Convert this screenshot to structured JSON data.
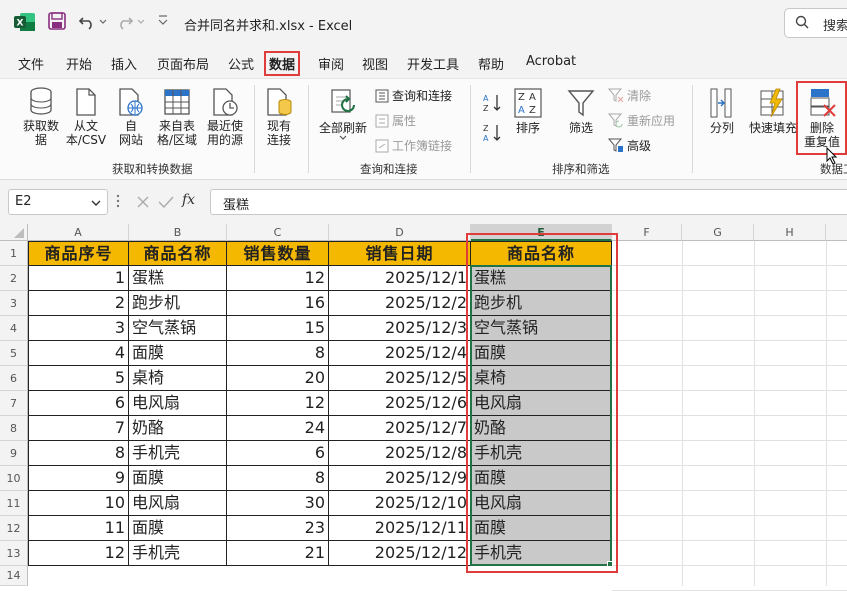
{
  "window": {
    "title": "合并同名并求和.xlsx  -  Excel",
    "search_label": "搜索"
  },
  "menu": [
    "文件",
    "开始",
    "插入",
    "页面布局",
    "公式",
    "数据",
    "审阅",
    "视图",
    "开发工具",
    "帮助",
    "Acrobat"
  ],
  "ribbon": {
    "get_data": "获取数\n据",
    "from_text_csv": "从文\n本/CSV",
    "from_web": "自\n网站",
    "from_table": "来自表\n格/区域",
    "recent_sources": "最近使\n用的源",
    "existing_connections": "现有\n连接",
    "group_get_transform": "获取和转换数据",
    "refresh_all": "全部刷新",
    "queries_connections": "查询和连接",
    "properties": "属性",
    "edit_links": "工作簿链接",
    "group_queries": "查询和连接",
    "sort_asc": "A↓Z",
    "sort_desc": "Z↓A",
    "sort": "排序",
    "filter": "筛选",
    "clear": "清除",
    "reapply": "重新应用",
    "advanced": "高级",
    "group_sort_filter": "排序和筛选",
    "text_to_columns": "分列",
    "flash_fill": "快速填充",
    "remove_duplicates": "删除\n重复值",
    "group_data_tools": "数据工"
  },
  "formula_bar": {
    "name_box": "E2",
    "fx": "fx",
    "value": "蛋糕"
  },
  "columns": [
    "A",
    "B",
    "C",
    "D",
    "E",
    "F",
    "G",
    "H"
  ],
  "rows": [
    "1",
    "2",
    "3",
    "4",
    "5",
    "6",
    "7",
    "8",
    "9",
    "10",
    "11",
    "12",
    "13",
    "14"
  ],
  "table": {
    "headers": [
      "商品序号",
      "商品名称",
      "销售数量",
      "销售日期",
      "商品名称"
    ],
    "rows": [
      [
        "1",
        "蛋糕",
        "12",
        "2025/12/1",
        "蛋糕"
      ],
      [
        "2",
        "跑步机",
        "16",
        "2025/12/2",
        "跑步机"
      ],
      [
        "3",
        "空气蒸锅",
        "15",
        "2025/12/3",
        "空气蒸锅"
      ],
      [
        "4",
        "面膜",
        "8",
        "2025/12/4",
        "面膜"
      ],
      [
        "5",
        "桌椅",
        "20",
        "2025/12/5",
        "桌椅"
      ],
      [
        "6",
        "电风扇",
        "12",
        "2025/12/6",
        "电风扇"
      ],
      [
        "7",
        "奶酪",
        "24",
        "2025/12/7",
        "奶酪"
      ],
      [
        "8",
        "手机壳",
        "6",
        "2025/12/8",
        "手机壳"
      ],
      [
        "9",
        "面膜",
        "8",
        "2025/12/9",
        "面膜"
      ],
      [
        "10",
        "电风扇",
        "30",
        "2025/12/10",
        "电风扇"
      ],
      [
        "11",
        "面膜",
        "23",
        "2025/12/11",
        "面膜"
      ],
      [
        "12",
        "手机壳",
        "21",
        "2025/12/12",
        "手机壳"
      ]
    ]
  },
  "colors": {
    "excel_green": "#217346",
    "header_fill": "#f5b800",
    "highlight_red": "#e03c3c",
    "selection_gray": "#c9c9c9"
  }
}
